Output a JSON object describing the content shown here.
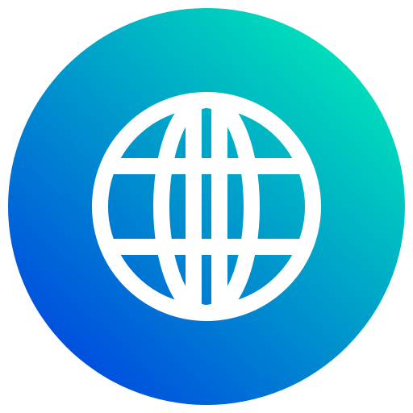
{
  "icon": {
    "name": "globe-icon",
    "gradient_start": "#0047E0",
    "gradient_end": "#00E6B8",
    "stroke_color": "#FFFFFF",
    "background": "#FFFFFF"
  }
}
